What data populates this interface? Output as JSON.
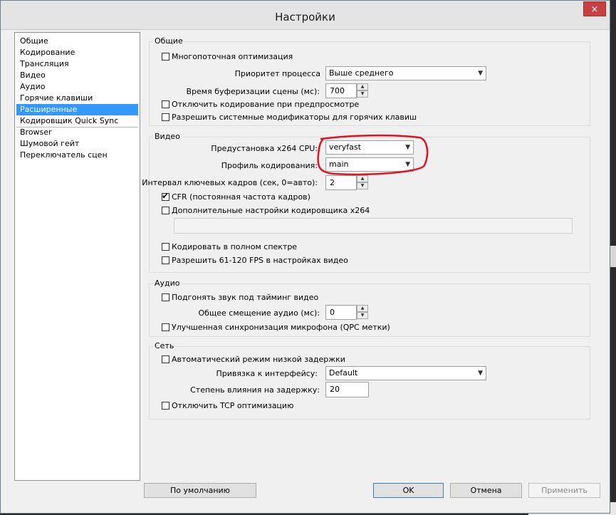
{
  "window": {
    "title": "Настройки",
    "close_icon": "×"
  },
  "sidebar": {
    "items": [
      {
        "label": "Общие"
      },
      {
        "label": "Кодирование"
      },
      {
        "label": "Трансляция"
      },
      {
        "label": "Видео"
      },
      {
        "label": "Аудио"
      },
      {
        "label": "Горячие клавиши"
      },
      {
        "label": "Расширенные",
        "selected": true
      },
      {
        "label": "Кодировщик Quick Sync"
      },
      {
        "label": "Browser"
      },
      {
        "label": "Шумовой гейт"
      },
      {
        "label": "Переключатель сцен"
      }
    ]
  },
  "general": {
    "title": "Общие",
    "multithread_label": "Многопоточная оптимизация",
    "multithread_checked": false,
    "priority_label": "Приоритет процесса",
    "priority_value": "Выше среднего",
    "buffer_label": "Время буферизации сцены (мс):",
    "buffer_value": "700",
    "disable_preview_label": "Отключить кодирование при предпросмотре",
    "disable_preview_checked": false,
    "allow_modifiers_label": "Разрешить системные модификаторы для горячих клавиш",
    "allow_modifiers_checked": false
  },
  "video": {
    "title": "Видео",
    "preset_label": "Предустановка x264 CPU:",
    "preset_value": "veryfast",
    "profile_label": "Профиль кодирования:",
    "profile_value": "main",
    "keyframe_label": "Интервал ключевых кадров (сек, 0=авто):",
    "keyframe_value": "2",
    "cfr_label": "CFR (постоянная частота кадров)",
    "cfr_checked": true,
    "advanced_x264_label": "Дополнительные настройки кодировщика x264",
    "advanced_x264_checked": false,
    "advanced_x264_value": "",
    "full_range_label": "Кодировать в полном спектре",
    "full_range_checked": false,
    "allow_fps_label": "Разрешить 61-120 FPS в настройках видео",
    "allow_fps_checked": false
  },
  "audio": {
    "title": "Аудио",
    "sync_label": "Подгонять звук под тайминг видео",
    "sync_checked": false,
    "offset_label": "Общее смещение аудио (мс):",
    "offset_value": "0",
    "mic_sync_label": "Улучшенная синхронизация микрофона (QPC метки)",
    "mic_sync_checked": false
  },
  "network": {
    "title": "Сеть",
    "low_latency_label": "Автоматический режим низкой задержки",
    "low_latency_checked": false,
    "bind_label": "Привязка к интерфейсу:",
    "bind_value": "Default",
    "latency_factor_label": "Степень влияния на задержку:",
    "latency_factor_value": "20",
    "disable_tcp_label": "Отключить TCP оптимизацию",
    "disable_tcp_checked": false
  },
  "buttons": {
    "defaults": "По умолчанию",
    "ok": "OK",
    "cancel": "Отмена",
    "apply": "Применить"
  },
  "colors": {
    "selection": "#3399ff",
    "annotation": "#e0141e"
  }
}
